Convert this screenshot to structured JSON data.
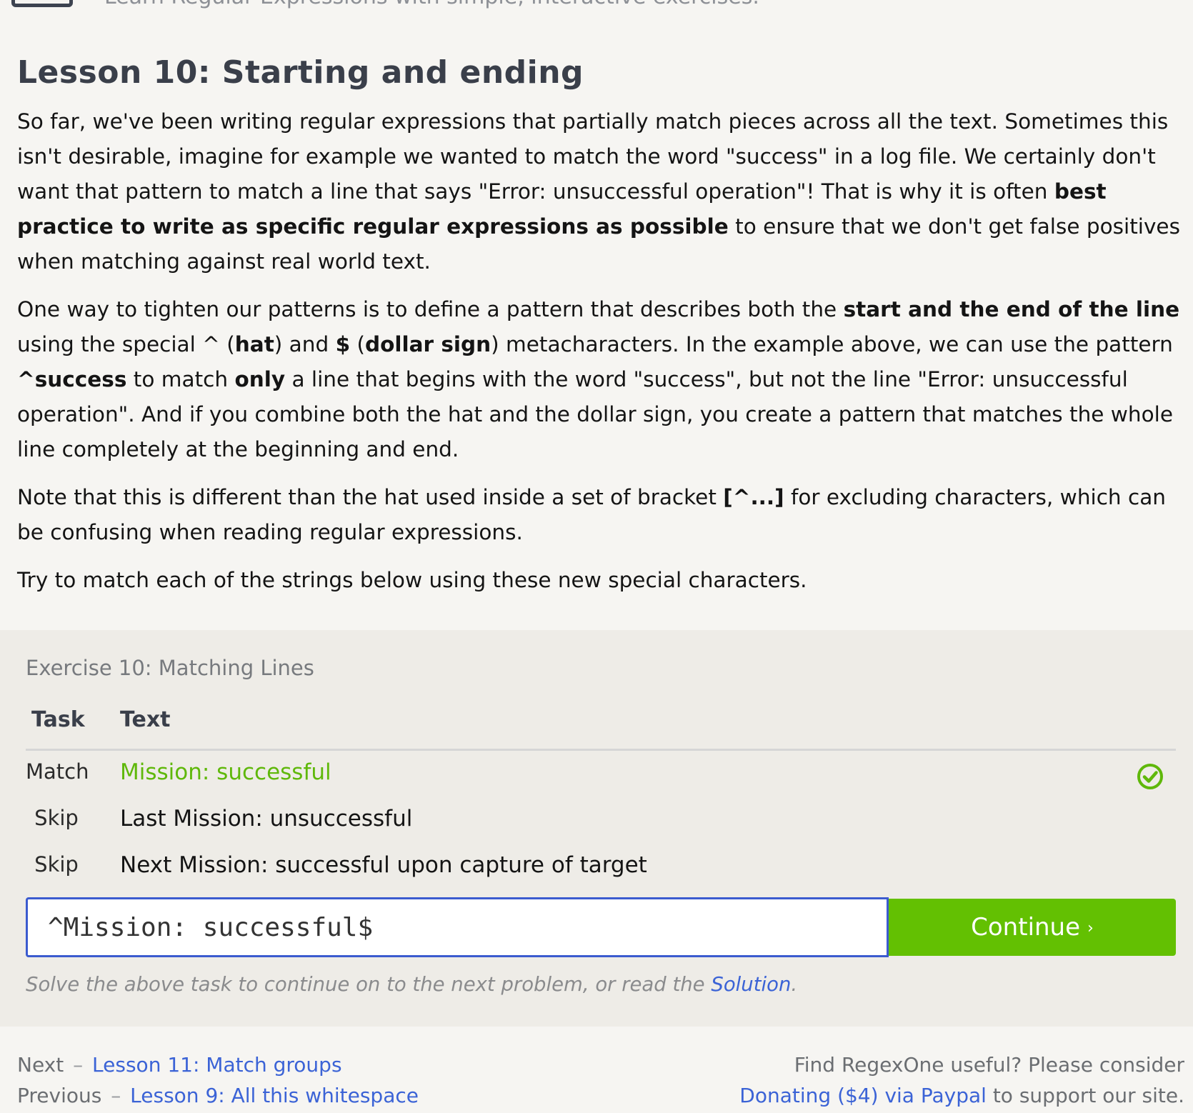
{
  "header": {
    "tagline": "Learn Regular Expressions with simple, interactive exercises."
  },
  "lesson": {
    "title": "Lesson 10: Starting and ending",
    "p1": {
      "a": "So far, we've been writing regular expressions that partially match pieces across all the text. Sometimes this isn't desirable, imagine for example we wanted to match the word \"success\" in a log file. We certainly don't want that pattern to match a line that says \"Error: unsuccessful operation\"! That is why it is often ",
      "b": "best practice to write as specific regular expressions as possible",
      "c": " to ensure that we don't get false positives when matching against real world text."
    },
    "p2": {
      "a": "One way to tighten our patterns is to define a pattern that describes both the ",
      "b": "start and the end of the line",
      "c": " using the special ^ (",
      "d": "hat",
      "e": ") and ",
      "f": "$",
      "g": " (",
      "h": "dollar sign",
      "i": ") metacharacters. In the example above, we can use the pattern ",
      "j": "^success",
      "k": " to match ",
      "l": "only",
      "m": " a line that begins with the word \"success\", but not the line \"Error: unsuccessful operation\". And if you combine both the hat and the dollar sign, you create a pattern that matches the whole line completely at the beginning and end."
    },
    "p3": {
      "a": "Note that this is different than the hat used inside a set of bracket ",
      "b": "[^...]",
      "c": " for excluding characters, which can be confusing when reading regular expressions."
    },
    "p4": "Try to match each of the strings below using these new special characters."
  },
  "exercise": {
    "title": "Exercise 10: Matching Lines",
    "header_task": "Task",
    "header_text": "Text",
    "rows": [
      {
        "task": "Match",
        "text": "Mission: successful",
        "matched": true,
        "icon": "check-circle-icon"
      },
      {
        "task": "Skip",
        "text": "Last Mission: unsuccessful",
        "matched": false
      },
      {
        "task": "Skip",
        "text": "Next Mission: successful upon capture of target",
        "matched": false
      }
    ],
    "input_value": "^Mission: successful$",
    "continue_label": "Continue",
    "continue_chevron": "›",
    "hint_prefix": "Solve the above task to continue on to the next problem, or read the ",
    "hint_link": "Solution",
    "hint_suffix": "."
  },
  "footer": {
    "next_label": "Next",
    "next_sep": "–",
    "next_link": "Lesson 11: Match groups",
    "prev_label": "Previous",
    "prev_sep": "–",
    "prev_link": "Lesson 9: All this whitespace",
    "donate_line1": "Find RegexOne useful? Please consider",
    "donate_link": "Donating ($4) via Paypal",
    "donate_suffix": " to support our site."
  },
  "colors": {
    "background": "#f6f5f2",
    "panel": "#eeece7",
    "accent_green": "#63c002",
    "matched_text": "#5fb80a",
    "link_blue": "#3b63d6",
    "input_border": "#3b5bcf"
  }
}
